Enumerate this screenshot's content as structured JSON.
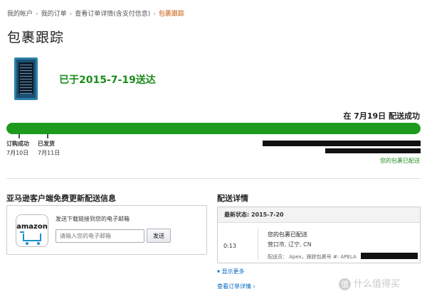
{
  "breadcrumb": {
    "items": [
      "我的帐户",
      "我的订单",
      "查看订单详情(含支付信息)"
    ],
    "separator": "›",
    "current": "包裹跟踪"
  },
  "page_title": "包裹跟踪",
  "product": {
    "image_icon": "e-reader-thumbnail"
  },
  "delivery": {
    "status_text": "已于2015-7-19送达",
    "delivered_on": "在 7月19日 配送成功",
    "progress_fraction": 1.0,
    "milestones": [
      {
        "label": "订购成功",
        "date": "7月10日"
      },
      {
        "label": "已发货",
        "date": "7月11日"
      }
    ],
    "update_status": "您的包裹已配送"
  },
  "app_section": {
    "title": "亚马逊客户端免费更新配送信息",
    "logo_text": "amazon",
    "logo_icon": "amazon-app-cart-icon",
    "prompt": "发送下载链接到您的电子邮箱",
    "email_placeholder": "请输入您的电子邮箱",
    "send_label": "发送"
  },
  "tracking": {
    "title": "配送详情",
    "latest_status": "最新状态: 2015-7-20",
    "event": {
      "time": "0:13",
      "status": "您的包裹已配送",
      "location": "营口市, 辽宁, CN",
      "carrier": "配送员： Apex，跟踪包裹号 #: APELA"
    },
    "show_more": "显示更多",
    "view_order": "查看订单详情 ›"
  },
  "watermark": {
    "badge": "值",
    "text": "什么值得买"
  },
  "colors": {
    "progress": "#1e9b1e",
    "status_green": "#1c8c1c",
    "link_blue": "#0066c0",
    "breadcrumb_current": "#c45500"
  }
}
